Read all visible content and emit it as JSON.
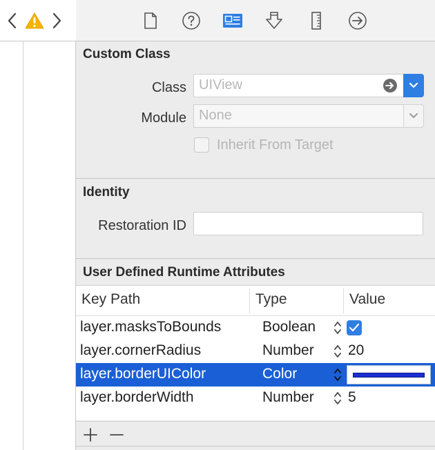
{
  "nav": {
    "back_icon": "chevron-left-icon",
    "warning_icon": "warning-icon",
    "forward_icon": "chevron-right-icon"
  },
  "inspector_tabs": [
    {
      "icon": "file-inspector-icon"
    },
    {
      "icon": "quick-help-icon"
    },
    {
      "icon": "identity-inspector-icon",
      "active": true
    },
    {
      "icon": "attributes-inspector-icon"
    },
    {
      "icon": "size-inspector-icon"
    },
    {
      "icon": "connections-inspector-icon"
    }
  ],
  "custom_class": {
    "title": "Custom Class",
    "class_label": "Class",
    "class_placeholder": "UIView",
    "module_label": "Module",
    "module_placeholder": "None",
    "inherit_label": "Inherit From Target"
  },
  "identity": {
    "title": "Identity",
    "restoration_label": "Restoration ID",
    "restoration_value": ""
  },
  "runtime_attributes": {
    "title": "User Defined Runtime Attributes",
    "columns": [
      "Key Path",
      "Type",
      "Value"
    ],
    "rows": [
      {
        "key_path": "layer.masksToBounds",
        "type": "Boolean",
        "value": ""
      },
      {
        "key_path": "layer.cornerRadius",
        "type": "Number",
        "value": "20"
      },
      {
        "key_path": "layer.borderUIColor",
        "type": "Color",
        "value": ""
      },
      {
        "key_path": "layer.borderWidth",
        "type": "Number",
        "value": "5"
      }
    ],
    "selected_row": 2
  },
  "footer": {
    "add_label": "+",
    "remove_label": "—"
  },
  "colors": {
    "accent": "#2f7ee2",
    "selection": "#1a5fd6",
    "warning": "#f4b400",
    "border_color_swatch": "#1b2fd1"
  }
}
